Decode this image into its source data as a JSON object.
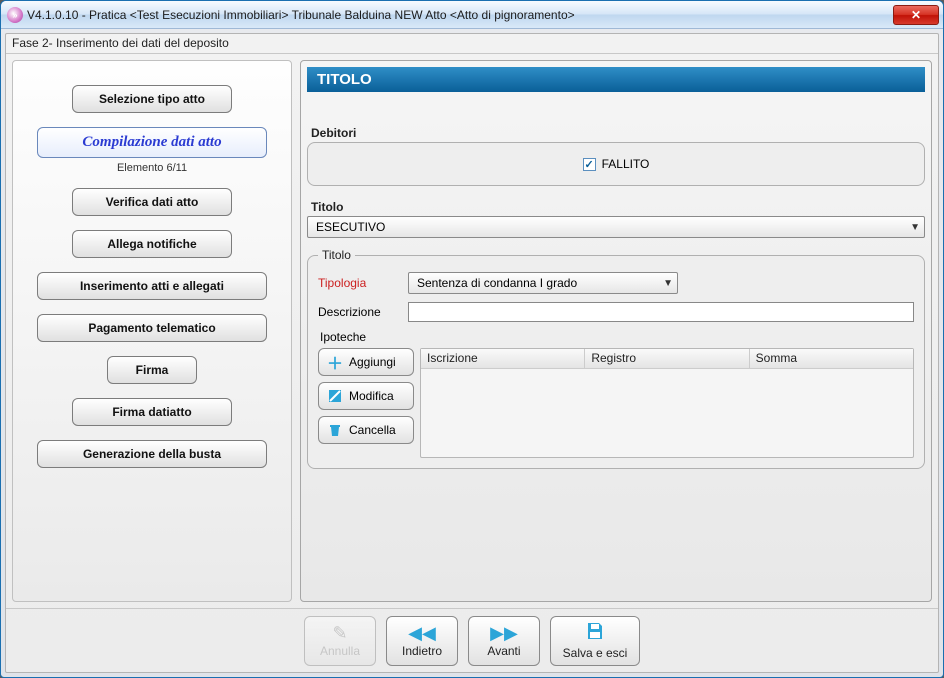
{
  "title": "V4.1.0.10 - Pratica <Test Esecuzioni Immobiliari>   Tribunale Balduina NEW   Atto <Atto di pignoramento>",
  "phase": "Fase 2- Inserimento dei dati del deposito",
  "sidebar": {
    "steps": [
      "Selezione tipo atto",
      "Compilazione dati atto",
      "Verifica dati atto",
      "Allega notifiche",
      "Inserimento atti e allegati",
      "Pagamento telematico",
      "Firma",
      "Firma datiatto",
      "Generazione della busta"
    ],
    "meta": "Elemento 6/11"
  },
  "main": {
    "header": "TITOLO",
    "debitori": {
      "label": "Debitori",
      "checkbox_label": "FALLITO",
      "checked": true
    },
    "titolo_select": {
      "label": "Titolo",
      "value": "ESECUTIVO"
    },
    "titolo_group": {
      "legend": "Titolo",
      "tipologia_label": "Tipologia",
      "tipologia_value": "Sentenza di condanna I grado",
      "descrizione_label": "Descrizione",
      "descrizione_value": ""
    },
    "ipoteche": {
      "label": "Ipoteche",
      "buttons": {
        "add": "Aggiungi",
        "edit": "Modifica",
        "delete": "Cancella"
      },
      "columns": [
        "Iscrizione",
        "Registro",
        "Somma"
      ]
    }
  },
  "footer": {
    "annulla": "Annulla",
    "indietro": "Indietro",
    "avanti": "Avanti",
    "salva": "Salva e esci"
  }
}
